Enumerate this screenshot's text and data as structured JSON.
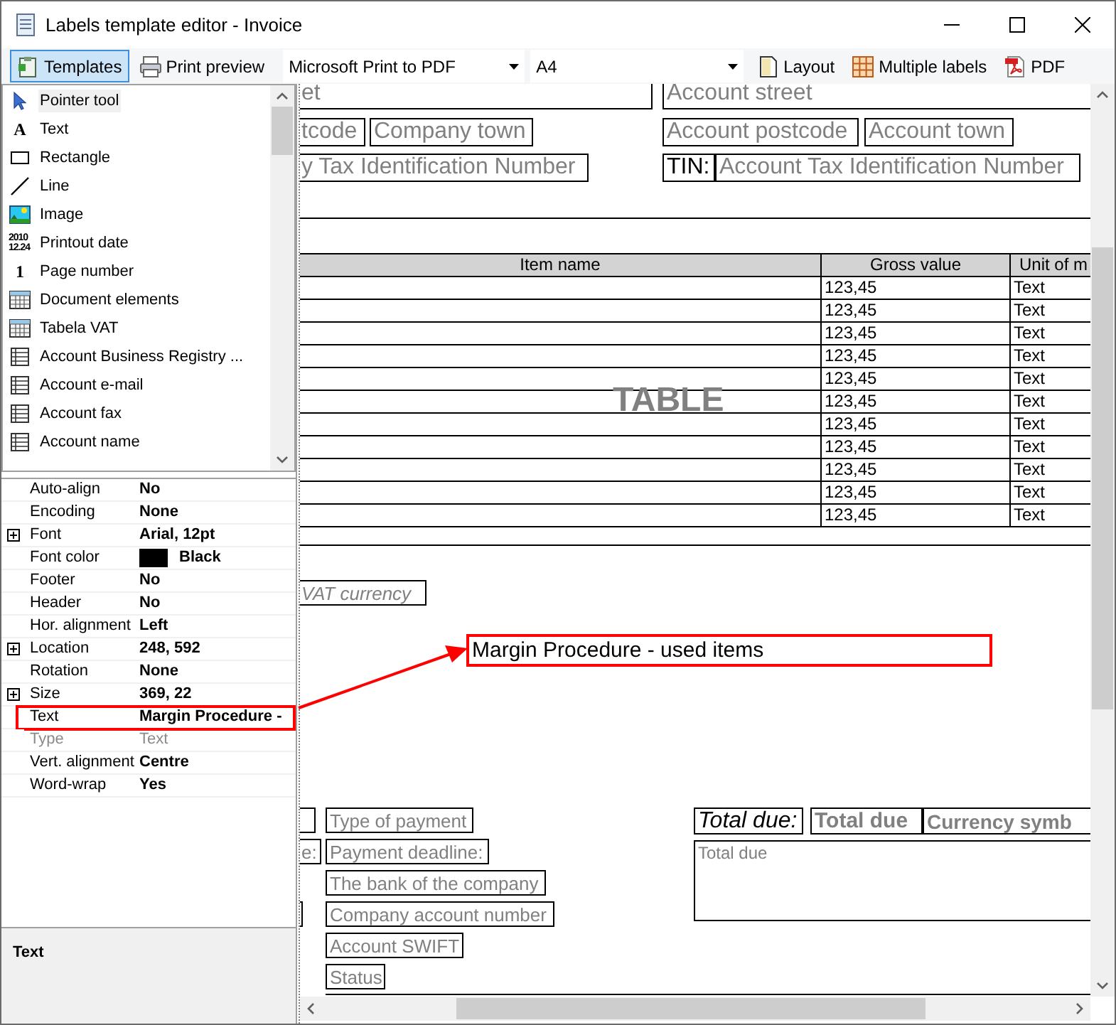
{
  "window": {
    "title": "Labels template editor - Invoice"
  },
  "toolbar": {
    "left_buttons": [
      {
        "label": "Templates",
        "selected": true,
        "kind": "templates"
      },
      {
        "label": "Print preview",
        "selected": false,
        "kind": "printer"
      }
    ],
    "printer": "Microsoft Print to PDF",
    "paper": "A4",
    "right_buttons": [
      {
        "label": "Layout",
        "kind": "page"
      },
      {
        "label": "Multiple labels",
        "kind": "grid"
      },
      {
        "label": "PDF",
        "kind": "pdf"
      }
    ]
  },
  "tools": [
    {
      "label": "Pointer tool",
      "kind": "pointer",
      "selected": true
    },
    {
      "label": "Text",
      "kind": "glyph",
      "glyph": "A",
      "selected": false
    },
    {
      "label": "Rectangle",
      "kind": "rectangle",
      "selected": false
    },
    {
      "label": "Line",
      "kind": "line",
      "selected": false
    },
    {
      "label": "Image",
      "kind": "image",
      "selected": false
    },
    {
      "label": "Printout date",
      "kind": "date",
      "glyph": "2010",
      "glyph2": "12.24",
      "selected": false
    },
    {
      "label": "Page number",
      "kind": "glyph",
      "glyph": "1",
      "selected": false
    },
    {
      "label": "Document elements",
      "kind": "table",
      "selected": false
    },
    {
      "label": "Tabela VAT",
      "kind": "table",
      "selected": false
    },
    {
      "label": "Account Business Registry ...",
      "kind": "list",
      "selected": false
    },
    {
      "label": "Account e-mail",
      "kind": "list",
      "selected": false
    },
    {
      "label": "Account fax",
      "kind": "list",
      "selected": false
    },
    {
      "label": "Account name",
      "kind": "list",
      "selected": false
    }
  ],
  "properties": [
    {
      "name": "Auto-align",
      "value": "No",
      "expandable": false,
      "disabled": false,
      "highlighted": false
    },
    {
      "name": "Encoding",
      "value": "None",
      "expandable": false,
      "disabled": false,
      "highlighted": false
    },
    {
      "name": "Font",
      "value": "Arial, 12pt",
      "expandable": true,
      "disabled": false,
      "highlighted": false
    },
    {
      "name": "Font color",
      "value": "Black",
      "expandable": false,
      "disabled": false,
      "highlighted": false,
      "color": "#000000"
    },
    {
      "name": "Footer",
      "value": "No",
      "expandable": false,
      "disabled": false,
      "highlighted": false
    },
    {
      "name": "Header",
      "value": "No",
      "expandable": false,
      "disabled": false,
      "highlighted": false
    },
    {
      "name": "Hor. alignment",
      "value": "Left",
      "expandable": false,
      "disabled": false,
      "highlighted": false
    },
    {
      "name": "Location",
      "value": "248, 592",
      "expandable": true,
      "disabled": false,
      "highlighted": false
    },
    {
      "name": "Rotation",
      "value": "None",
      "expandable": false,
      "disabled": false,
      "highlighted": false
    },
    {
      "name": "Size",
      "value": "369, 22",
      "expandable": true,
      "disabled": false,
      "highlighted": false
    },
    {
      "name": "Text",
      "value": "Margin Procedure -",
      "expandable": false,
      "disabled": false,
      "highlighted": true
    },
    {
      "name": "Type",
      "value": "Text",
      "expandable": false,
      "disabled": true,
      "highlighted": false
    },
    {
      "name": "Vert. alignment",
      "value": "Centre",
      "expandable": false,
      "disabled": false,
      "highlighted": false
    },
    {
      "name": "Word-wrap",
      "value": "Yes",
      "expandable": false,
      "disabled": false,
      "highlighted": false
    }
  ],
  "description": "Text",
  "canvas": {
    "fields": [
      {
        "text": "et",
        "kind": "placeholder",
        "selected": false
      },
      {
        "text": "Account street",
        "kind": "placeholder",
        "selected": false
      },
      {
        "text": "tcode",
        "kind": "placeholder",
        "selected": false
      },
      {
        "text": "Company town",
        "kind": "placeholder",
        "selected": false
      },
      {
        "text": "Account postcode",
        "kind": "placeholder",
        "selected": false
      },
      {
        "text": "Account town",
        "kind": "placeholder",
        "selected": false
      },
      {
        "text": "y Tax Identification Number",
        "kind": "placeholder",
        "selected": false
      },
      {
        "text": "TIN:",
        "kind": "caption",
        "selected": false
      },
      {
        "text": "Account Tax Identification Number",
        "kind": "placeholder",
        "selected": false
      },
      {
        "text": "VAT currency",
        "kind": "placeholder_italic",
        "selected": false
      },
      {
        "text": "Margin Procedure - used items",
        "kind": "caption",
        "selected": true
      },
      {
        "text": "Type of payment",
        "kind": "placeholder",
        "selected": false
      },
      {
        "text": "e:",
        "kind": "placeholder",
        "selected": false
      },
      {
        "text": "Payment deadline:",
        "kind": "placeholder",
        "selected": false
      },
      {
        "text": "The bank of the company",
        "kind": "placeholder",
        "selected": false
      },
      {
        "text": "Company account number",
        "kind": "placeholder",
        "selected": false
      },
      {
        "text": "Account SWIFT",
        "kind": "placeholder",
        "selected": false
      },
      {
        "text": "Status",
        "kind": "placeholder",
        "selected": false
      },
      {
        "text": "Total due:",
        "kind": "caption_italic",
        "selected": false
      },
      {
        "text": "Total due",
        "kind": "placeholder_bold",
        "selected": false
      },
      {
        "text": "Currency symb",
        "kind": "placeholder_bold",
        "selected": false
      },
      {
        "text": "Total due",
        "kind": "note",
        "selected": false
      }
    ],
    "table": {
      "columns": [
        "Item name",
        "Gross value",
        "Unit of m"
      ],
      "overlay_label": "TABLE",
      "rows": [
        {
          "gross_value": "123,45",
          "unit": "Text"
        },
        {
          "gross_value": "123,45",
          "unit": "Text"
        },
        {
          "gross_value": "123,45",
          "unit": "Text"
        },
        {
          "gross_value": "123,45",
          "unit": "Text"
        },
        {
          "gross_value": "123,45",
          "unit": "Text"
        },
        {
          "gross_value": "123,45",
          "unit": "Text"
        },
        {
          "gross_value": "123,45",
          "unit": "Text"
        },
        {
          "gross_value": "123,45",
          "unit": "Text"
        },
        {
          "gross_value": "123,45",
          "unit": "Text"
        },
        {
          "gross_value": "123,45",
          "unit": "Text"
        },
        {
          "gross_value": "123,45",
          "unit": "Text"
        }
      ]
    }
  }
}
